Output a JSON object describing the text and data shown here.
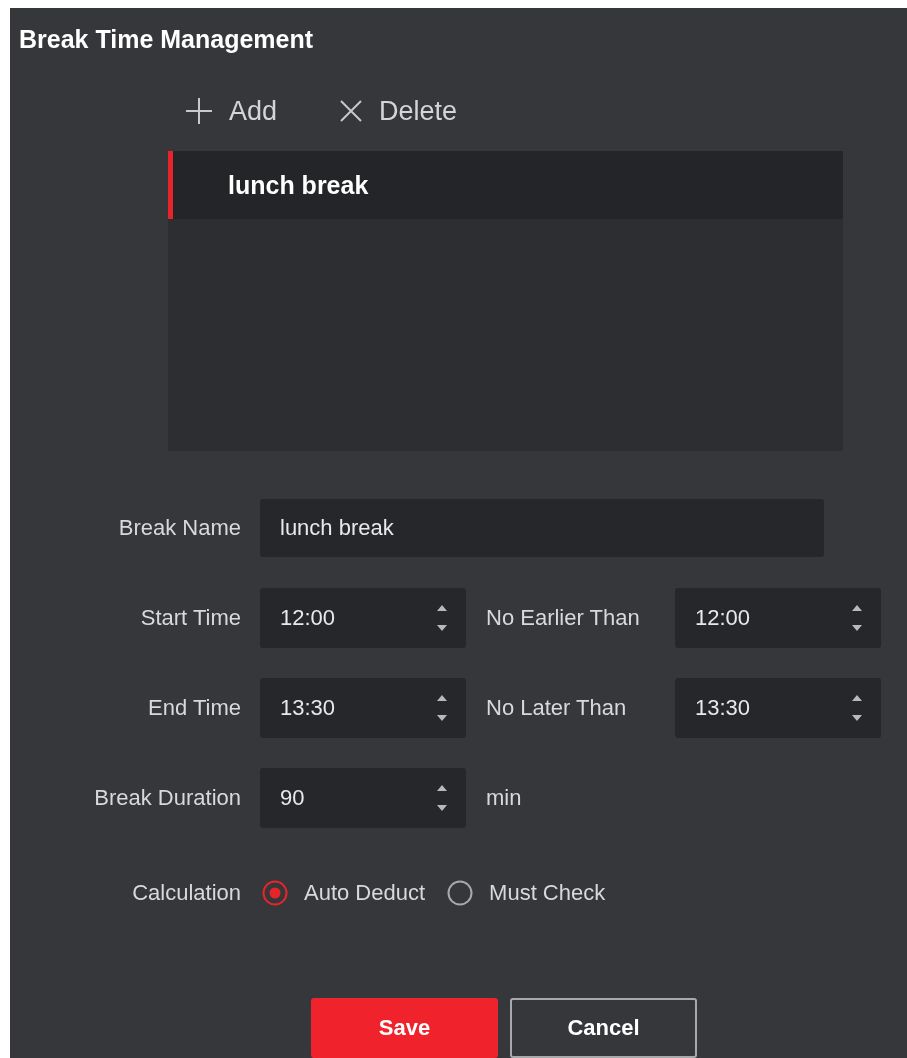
{
  "title": "Break Time Management",
  "toolbar": [
    {
      "kind": "add",
      "label": "Add"
    },
    {
      "kind": "delete",
      "label": "Delete"
    }
  ],
  "list": {
    "items": [
      {
        "label": "lunch break",
        "selected": true
      }
    ]
  },
  "form": {
    "break_name": {
      "label": "Break Name",
      "value": "lunch break"
    },
    "time_rows": [
      {
        "label": "Start Time",
        "value": "12:00",
        "limit_label": "No Earlier Than",
        "limit_value": "12:00"
      },
      {
        "label": "End Time",
        "value": "13:30",
        "limit_label": "No Later Than",
        "limit_value": "13:30"
      }
    ],
    "duration": {
      "label": "Break Duration",
      "value": "90",
      "unit": "min"
    },
    "calculation": {
      "label": "Calculation",
      "options": [
        {
          "label": "Auto Deduct",
          "selected": true
        },
        {
          "label": "Must Check",
          "selected": false
        }
      ]
    }
  },
  "buttons": [
    {
      "kind": "primary",
      "label": "Save"
    },
    {
      "kind": "secondary",
      "label": "Cancel"
    }
  ]
}
